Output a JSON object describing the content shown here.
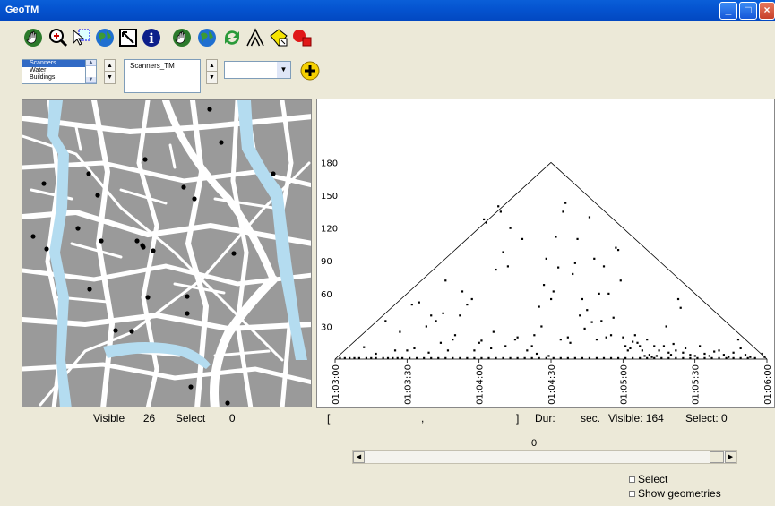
{
  "window": {
    "title": "GeoTM"
  },
  "colors": {
    "title_bar": "#0554d0",
    "map_streets": "#ffffff",
    "map_blocks": "#9a9a9a",
    "map_water": "#b4dcf0",
    "list_selection": "#316ac5"
  },
  "toolbar": {
    "icons": [
      "pan-hand-icon",
      "zoom-in-icon",
      "select-arrow-icon",
      "globe-icon",
      "zoom-extent-icon",
      "info-icon",
      "pan-hand-icon",
      "globe-icon",
      "refresh-icon",
      "triangle-icon",
      "diamond-tag-icon",
      "red-marker-icon"
    ]
  },
  "layers": {
    "items": [
      "Scanners",
      "Water",
      "Buildings"
    ],
    "selected_index": 0
  },
  "attribute_box": {
    "value": "Scanners_TM"
  },
  "combo": {
    "value": ""
  },
  "map": {
    "points": [
      [
        209,
        10
      ],
      [
        222,
        47
      ],
      [
        137,
        66
      ],
      [
        280,
        82
      ],
      [
        74,
        82
      ],
      [
        24,
        93
      ],
      [
        84,
        106
      ],
      [
        180,
        97
      ],
      [
        192,
        110
      ],
      [
        62,
        143
      ],
      [
        12,
        152
      ],
      [
        27,
        166
      ],
      [
        88,
        157
      ],
      [
        128,
        157
      ],
      [
        135,
        164
      ],
      [
        146,
        168
      ],
      [
        134,
        162
      ],
      [
        236,
        171
      ],
      [
        75,
        211
      ],
      [
        140,
        220
      ],
      [
        184,
        219
      ],
      [
        184,
        238
      ],
      [
        104,
        257
      ],
      [
        122,
        258
      ],
      [
        188,
        320
      ],
      [
        229,
        338
      ]
    ]
  },
  "map_status": {
    "visible_label": "Visible",
    "visible_value": "26",
    "select_label": "Select",
    "select_value": "0"
  },
  "chart_status": {
    "bracket_open": "[",
    "comma": ",",
    "bracket_close": "]",
    "dur_label": "Dur:",
    "sec_label": "sec.",
    "visible_text": "Visible: 164",
    "select_text": "Select:  0"
  },
  "slider": {
    "value": "0"
  },
  "options": {
    "select_label": "Select",
    "show_geometries_label": "Show geometries"
  },
  "chart_data": {
    "type": "scatter",
    "title": "",
    "xlabel": "",
    "ylabel": "",
    "x_range": [
      "01:03:00",
      "01:06:00"
    ],
    "x_ticks": [
      "01:03:00",
      "01:03:30",
      "01:04:00",
      "01:04:30",
      "01:05:00",
      "01:05:30",
      "01:06:00"
    ],
    "y_ticks": [
      30,
      60,
      90,
      120,
      150,
      180
    ],
    "ylim": [
      0,
      180
    ],
    "grid": false,
    "envelope_triangle": {
      "apex_x_sec": 90,
      "apex_y": 180
    },
    "x_unit": "seconds after 01:03:00",
    "points": [
      [
        2,
        1
      ],
      [
        4,
        1
      ],
      [
        6,
        1
      ],
      [
        8,
        1
      ],
      [
        10,
        1
      ],
      [
        13,
        1
      ],
      [
        15,
        1
      ],
      [
        17,
        1
      ],
      [
        20,
        1
      ],
      [
        22,
        1
      ],
      [
        24,
        1
      ],
      [
        26,
        1
      ],
      [
        28,
        1
      ],
      [
        31,
        1
      ],
      [
        34,
        1
      ],
      [
        37,
        1
      ],
      [
        40,
        1
      ],
      [
        43,
        1
      ],
      [
        46,
        1
      ],
      [
        49,
        1
      ],
      [
        52,
        1
      ],
      [
        55,
        1
      ],
      [
        58,
        1
      ],
      [
        61,
        1
      ],
      [
        64,
        1
      ],
      [
        67,
        1
      ],
      [
        70,
        1
      ],
      [
        73,
        1
      ],
      [
        76,
        1
      ],
      [
        79,
        1
      ],
      [
        82,
        1
      ],
      [
        85,
        1
      ],
      [
        88,
        1
      ],
      [
        91,
        1
      ],
      [
        94,
        1
      ],
      [
        97,
        1
      ],
      [
        100,
        1
      ],
      [
        103,
        1
      ],
      [
        106,
        1
      ],
      [
        109,
        1
      ],
      [
        112,
        1
      ],
      [
        115,
        1
      ],
      [
        118,
        1
      ],
      [
        121,
        1
      ],
      [
        124,
        1
      ],
      [
        127,
        1
      ],
      [
        130,
        1
      ],
      [
        133,
        1
      ],
      [
        136,
        1
      ],
      [
        139,
        1
      ],
      [
        142,
        1
      ],
      [
        145,
        1
      ],
      [
        148,
        1
      ],
      [
        151,
        1
      ],
      [
        154,
        1
      ],
      [
        157,
        1
      ],
      [
        160,
        1
      ],
      [
        163,
        1
      ],
      [
        166,
        1
      ],
      [
        169,
        1
      ],
      [
        172,
        1
      ],
      [
        175,
        1
      ],
      [
        12,
        11
      ],
      [
        17,
        5
      ],
      [
        21,
        35
      ],
      [
        25,
        8
      ],
      [
        27,
        25
      ],
      [
        30,
        8
      ],
      [
        32,
        50
      ],
      [
        33,
        10
      ],
      [
        35,
        52
      ],
      [
        38,
        30
      ],
      [
        39,
        6
      ],
      [
        40,
        40
      ],
      [
        42,
        35
      ],
      [
        44,
        15
      ],
      [
        45,
        42
      ],
      [
        46,
        72
      ],
      [
        47,
        8
      ],
      [
        49,
        18
      ],
      [
        50,
        22
      ],
      [
        52,
        40
      ],
      [
        53,
        62
      ],
      [
        55,
        50
      ],
      [
        57,
        55
      ],
      [
        58,
        8
      ],
      [
        60,
        15
      ],
      [
        61,
        17
      ],
      [
        62,
        128
      ],
      [
        63,
        125
      ],
      [
        65,
        10
      ],
      [
        66,
        25
      ],
      [
        67,
        82
      ],
      [
        68,
        140
      ],
      [
        69,
        135
      ],
      [
        70,
        98
      ],
      [
        71,
        12
      ],
      [
        72,
        85
      ],
      [
        73,
        120
      ],
      [
        75,
        18
      ],
      [
        76,
        20
      ],
      [
        78,
        110
      ],
      [
        80,
        8
      ],
      [
        82,
        12
      ],
      [
        83,
        22
      ],
      [
        84,
        5
      ],
      [
        85,
        48
      ],
      [
        86,
        30
      ],
      [
        87,
        68
      ],
      [
        88,
        92
      ],
      [
        89,
        3
      ],
      [
        90,
        55
      ],
      [
        91,
        62
      ],
      [
        92,
        112
      ],
      [
        93,
        84
      ],
      [
        94,
        18
      ],
      [
        95,
        135
      ],
      [
        96,
        143
      ],
      [
        97,
        20
      ],
      [
        98,
        15
      ],
      [
        99,
        78
      ],
      [
        100,
        88
      ],
      [
        101,
        110
      ],
      [
        102,
        40
      ],
      [
        103,
        55
      ],
      [
        104,
        28
      ],
      [
        105,
        45
      ],
      [
        106,
        130
      ],
      [
        107,
        34
      ],
      [
        108,
        92
      ],
      [
        109,
        18
      ],
      [
        110,
        60
      ],
      [
        111,
        35
      ],
      [
        112,
        85
      ],
      [
        113,
        20
      ],
      [
        114,
        60
      ],
      [
        115,
        22
      ],
      [
        116,
        38
      ],
      [
        117,
        102
      ],
      [
        118,
        100
      ],
      [
        119,
        72
      ],
      [
        120,
        20
      ],
      [
        121,
        12
      ],
      [
        122,
        8
      ],
      [
        123,
        10
      ],
      [
        124,
        16
      ],
      [
        125,
        22
      ],
      [
        126,
        15
      ],
      [
        127,
        12
      ],
      [
        128,
        8
      ],
      [
        129,
        3
      ],
      [
        130,
        18
      ],
      [
        131,
        4
      ],
      [
        132,
        2
      ],
      [
        133,
        12
      ],
      [
        134,
        3
      ],
      [
        135,
        8
      ],
      [
        137,
        12
      ],
      [
        138,
        30
      ],
      [
        139,
        6
      ],
      [
        140,
        4
      ],
      [
        141,
        14
      ],
      [
        142,
        8
      ],
      [
        143,
        55
      ],
      [
        144,
        47
      ],
      [
        145,
        6
      ],
      [
        146,
        10
      ],
      [
        148,
        4
      ],
      [
        150,
        3
      ],
      [
        152,
        12
      ],
      [
        154,
        5
      ],
      [
        156,
        3
      ],
      [
        158,
        7
      ],
      [
        160,
        8
      ],
      [
        162,
        4
      ],
      [
        164,
        2
      ],
      [
        166,
        6
      ],
      [
        168,
        18
      ],
      [
        169,
        10
      ],
      [
        171,
        4
      ],
      [
        173,
        2
      ],
      [
        178,
        5
      ],
      [
        179,
        2
      ]
    ]
  }
}
